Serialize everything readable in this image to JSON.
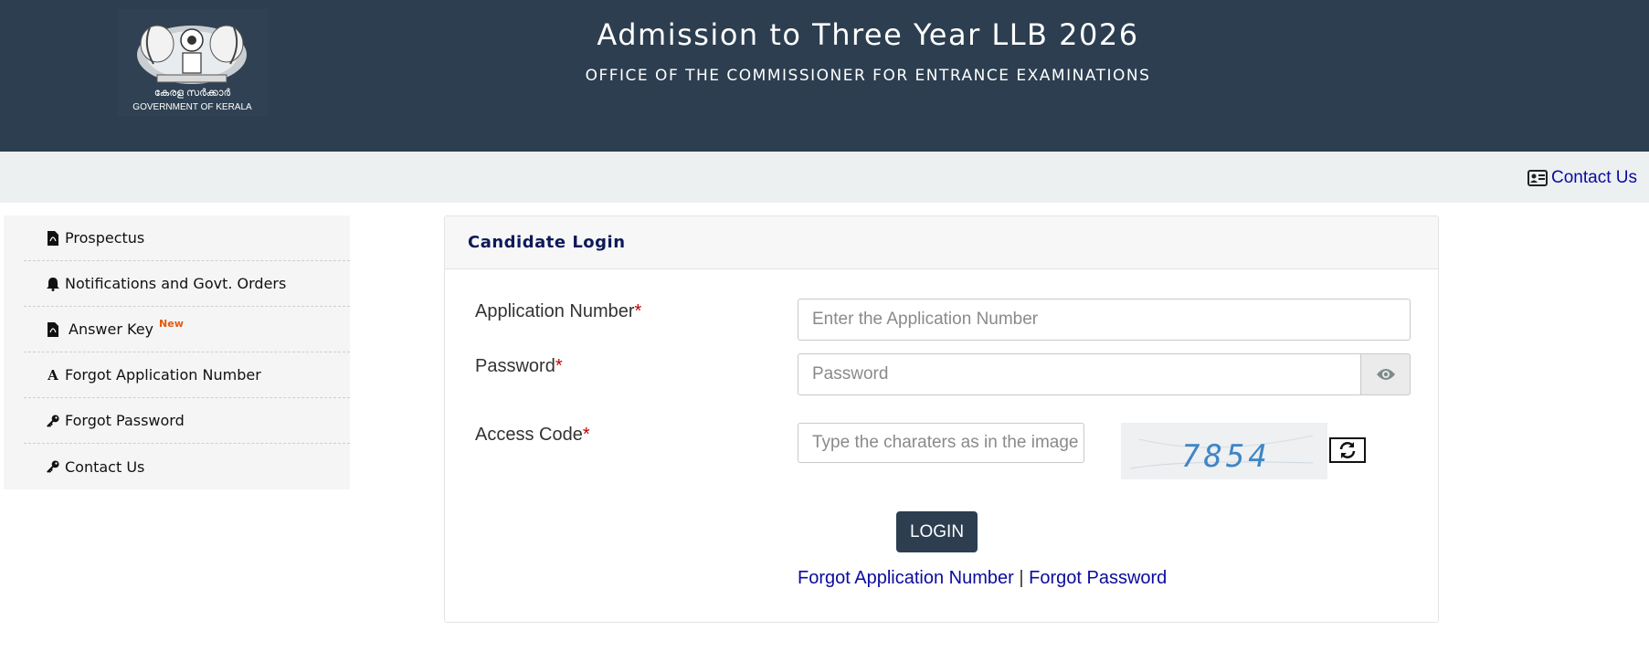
{
  "header": {
    "emblem_text_ml": "കേരള സർക്കാർ",
    "emblem_text_en": "GOVERNMENT OF KERALA",
    "title": "Admission to Three Year LLB 2026",
    "subtitle": "OFFICE OF THE COMMISSIONER FOR ENTRANCE EXAMINATIONS"
  },
  "topbar": {
    "contact_label": "Contact Us",
    "contact_icon": "contact-card-icon"
  },
  "sidebar": {
    "items": [
      {
        "label": "Prospectus",
        "icon": "pdf-file-icon"
      },
      {
        "label": "Notifications and Govt. Orders",
        "icon": "bell-icon"
      },
      {
        "label": "Answer Key",
        "icon": "pdf-file-icon",
        "badge": "New"
      },
      {
        "label": "Forgot Application Number",
        "icon": "font-a-icon"
      },
      {
        "label": "Forgot Password",
        "icon": "key-icon"
      },
      {
        "label": "Contact Us",
        "icon": "key-icon"
      }
    ]
  },
  "login": {
    "title": "Candidate Login",
    "required_mark": "*",
    "application_label": "Application Number",
    "application_placeholder": "Enter the Application Number",
    "password_label": "Password",
    "password_placeholder": "Password",
    "access_label": "Access Code",
    "access_placeholder": "Type the charaters as in the image",
    "captcha_text": "7854",
    "login_button": "LOGIN",
    "forgot_app_link": "Forgot Application Number",
    "separator": "|",
    "forgot_pwd_link": "Forgot Password"
  },
  "colors": {
    "header_bg": "#2c3e50",
    "topbar_bg": "#ecf0f1",
    "link": "#0b0b9e",
    "required": "#c00000",
    "badge": "#e05a12"
  }
}
